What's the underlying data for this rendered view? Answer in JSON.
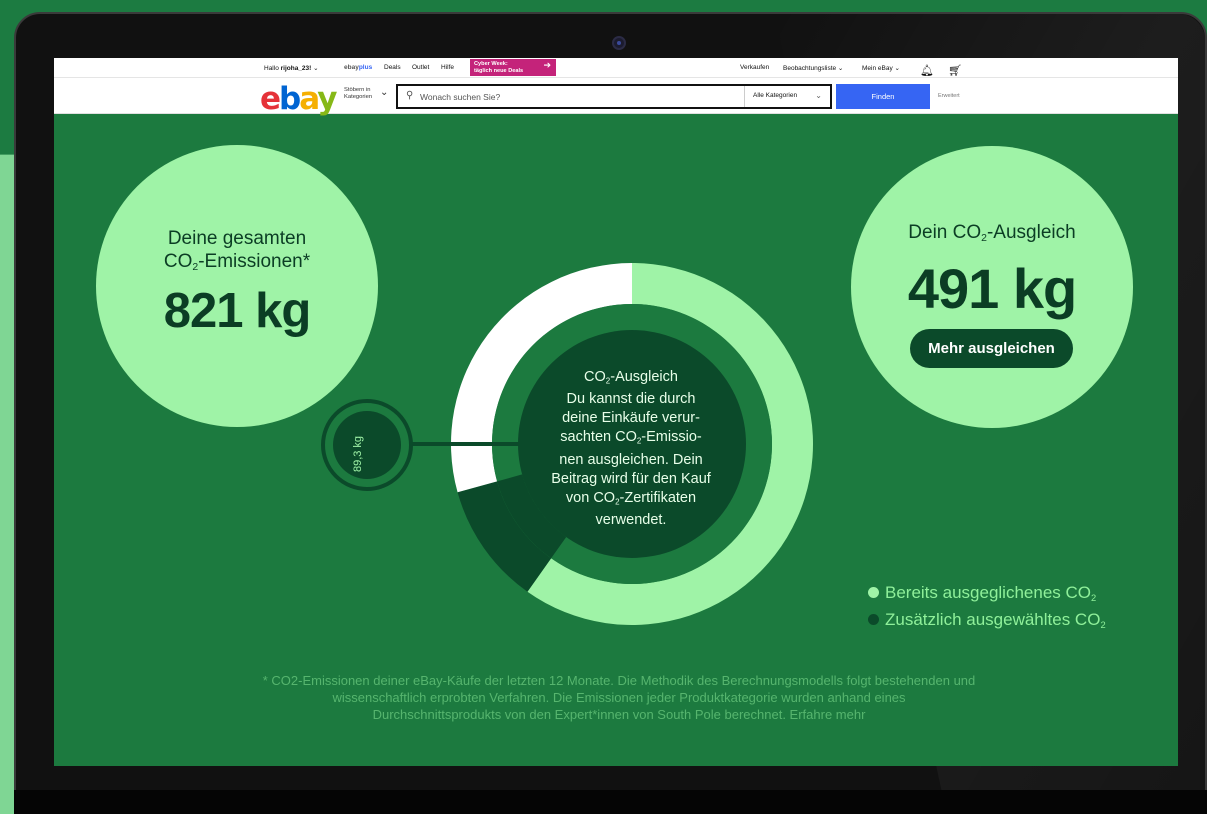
{
  "topbar": {
    "greeting_prefix": "Hallo ",
    "username": "rijoha_23!",
    "user_chevron": "⌄",
    "ebayplus_brand": "ebay",
    "ebayplus_suffix": "plus",
    "deals": "Deals",
    "outlet": "Outlet",
    "help": "Hilfe",
    "cyber_line1": "Cyber Week:",
    "cyber_line2": "täglich neue Deals",
    "sell": "Verkaufen",
    "watchlist": "Beobachtungsliste ⌄",
    "my_ebay": "Mein eBay ⌄"
  },
  "search": {
    "browse_line1": "Stöbern in",
    "browse_line2": "Kategorien",
    "placeholder": "Wonach suchen Sie?",
    "category": "Alle Kategorien",
    "find_button": "Finden",
    "advanced": "Erweitert"
  },
  "emissions": {
    "label_line1": "Deine gesamten",
    "label_co": "CO",
    "label_sub": "2",
    "label_rest": "-Emissionen*",
    "value": "821 kg"
  },
  "offset": {
    "label_co": "Dein CO",
    "label_sub": "2",
    "label_rest": "-Ausgleich",
    "value": "491 kg",
    "button": "Mehr ausgleichen"
  },
  "donut": {
    "side_value": "89,3 kg",
    "already_offset_fraction": 0.598,
    "additional_fraction": 0.109,
    "remaining_fraction": 0.293
  },
  "center_text": {
    "line1_co": "CO",
    "line1_rest": "-Ausgleich",
    "line2": "Du kannst die durch",
    "line3": "deine Einkäufe verur-",
    "line4_a": "sachten CO",
    "line4_b": "-Emissio-",
    "line5": "nen ausgleichen. Dein",
    "line6": "Beitrag wird für den Kauf",
    "line7_a": "von CO",
    "line7_b": "-Zertifikaten",
    "line8": "verwendet.",
    "sub": "2"
  },
  "legend": {
    "item1": "Bereits ausgeglichenes CO",
    "item2": "Zusätzlich ausgewähltes CO",
    "sub": "2",
    "color1": "#9ff3a7",
    "color2": "#0b4a2a"
  },
  "footnote": {
    "line1": "* CO2-Emissionen deiner eBay-Käufe der letzten 12 Monate. Die Methodik des Berechnungsmodells folgt bestehenden und",
    "line2": "wissenschaftlich erprobten Verfahren. Die Emissionen jeder Produktkategorie wurden anhand eines",
    "line3": "Durchschnittsprodukts von den Expert*innen von South Pole berechnet. Erfahre mehr"
  },
  "colors": {
    "screen_bg": "#1c7a3f",
    "bubble": "#9ff3a7",
    "dark_green": "#0b4a2a",
    "search_button": "#3665f3",
    "cyber_badge": "#c4237a"
  }
}
